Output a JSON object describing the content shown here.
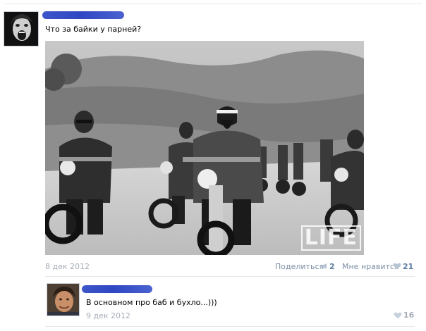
{
  "post": {
    "author_name": "",
    "text": "Что за байки у парней?",
    "date": "8 дек 2012",
    "watermark": "LIFE",
    "share_label": "Поделиться",
    "share_count": "2",
    "like_label": "Мне нравится",
    "like_count": "21"
  },
  "comment": {
    "author_name": "",
    "text": "В основном про баб и бухло...)))",
    "date": "9 дек 2012",
    "like_count": "16"
  },
  "colors": {
    "link": "#7d8fa5",
    "count": "#5e7ea1",
    "muted": "#a6adb7",
    "redaction": "#3d56c9"
  },
  "icons": {
    "share": "megaphone-icon",
    "like": "heart-icon"
  }
}
